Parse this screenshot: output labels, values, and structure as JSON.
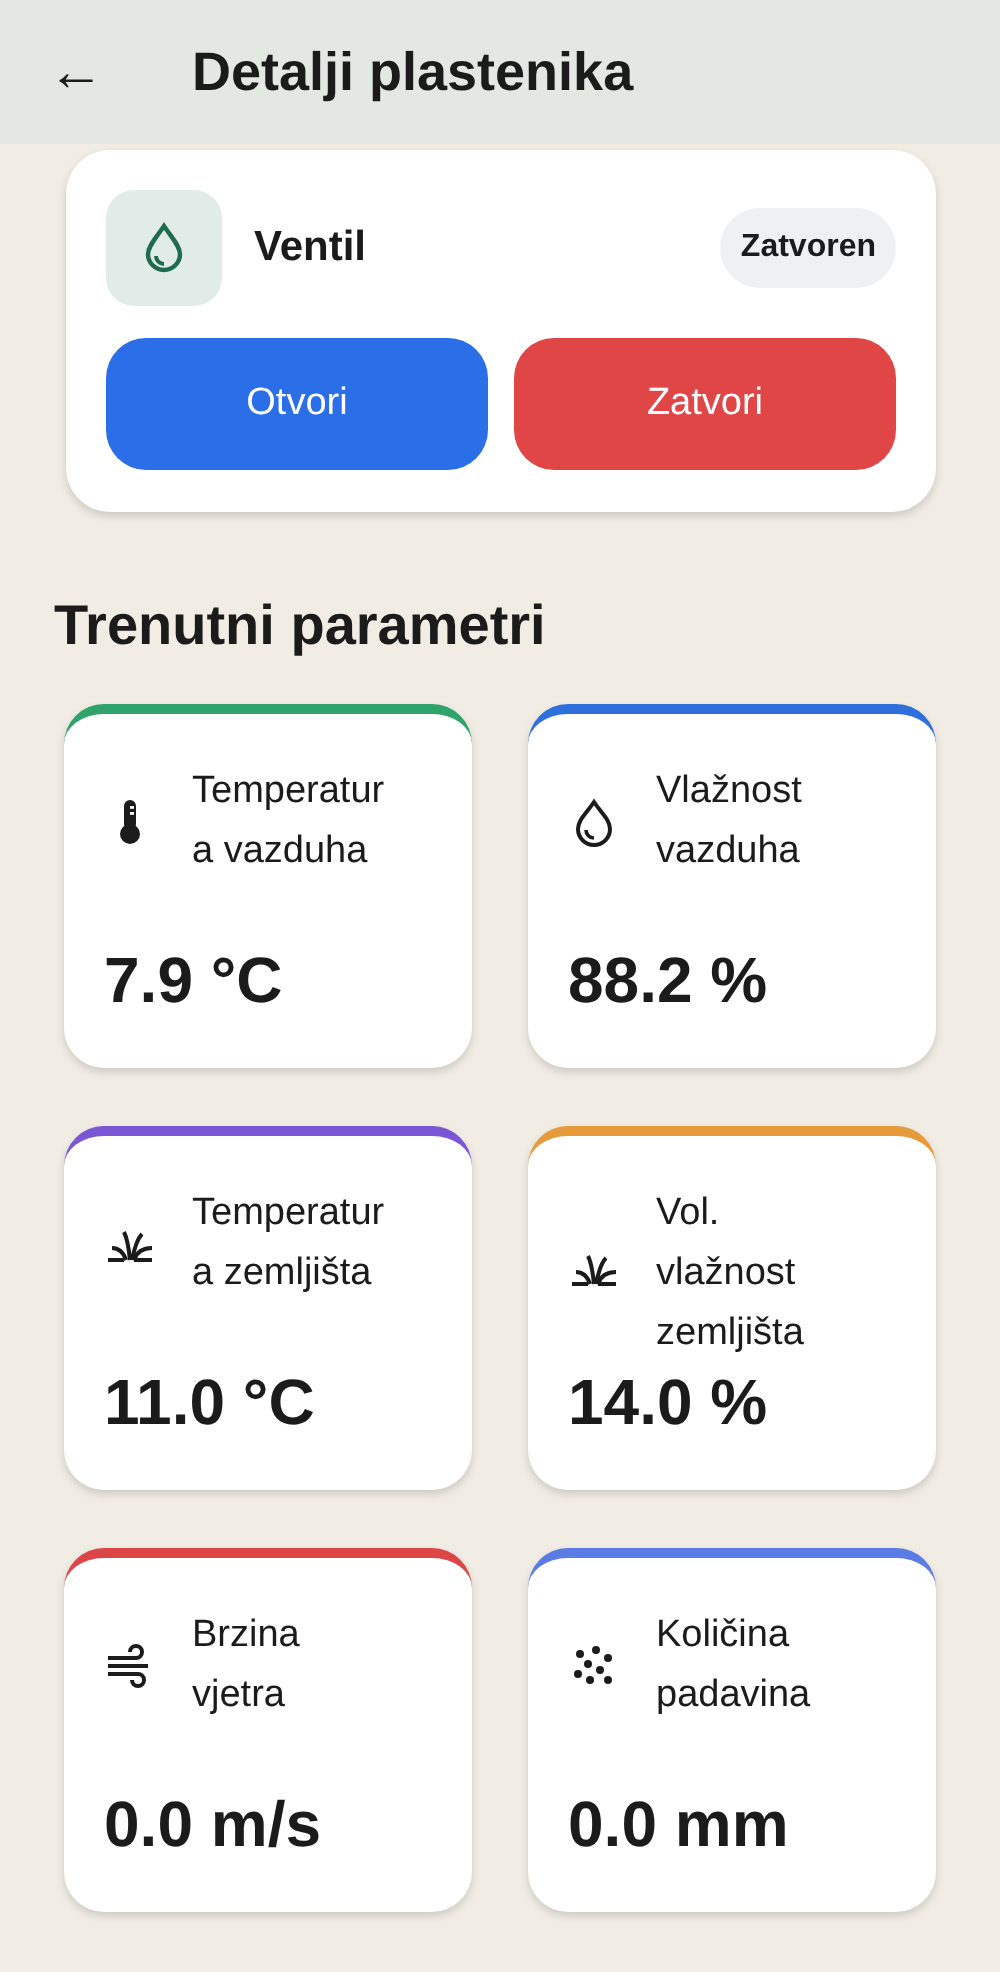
{
  "header": {
    "back_icon": "←",
    "title": "Detalji plastenika"
  },
  "valve": {
    "name": "Ventil",
    "status": "Zatvoren",
    "buttons": [
      {
        "label": "Otvori",
        "kind": "open"
      },
      {
        "label": "Zatvori",
        "kind": "close"
      }
    ]
  },
  "section_title": "Trenutni parametri",
  "metrics": [
    {
      "label": "Temperatura vazduha",
      "value": "7.9 °C",
      "kind": "thermometer",
      "color": "#2fa36b"
    },
    {
      "label": "Vlažnost vazduha",
      "value": "88.2 %",
      "kind": "drop",
      "color": "#2f6fdc"
    },
    {
      "label": "Temperatura zemljišta",
      "value": "11.0 °C",
      "kind": "sprout",
      "color": "#7a55d6"
    },
    {
      "label": "Vol. vlažnost zemljišta",
      "value": "14.0 %",
      "kind": "sprout",
      "color": "#e79a3a"
    },
    {
      "label": "Brzina vjetra",
      "value": "0.0 m/s",
      "kind": "wind",
      "color": "#dd4646"
    },
    {
      "label": "Količina padavina",
      "value": "0.0 mm",
      "kind": "dots",
      "color": "#5b7be6"
    }
  ]
}
